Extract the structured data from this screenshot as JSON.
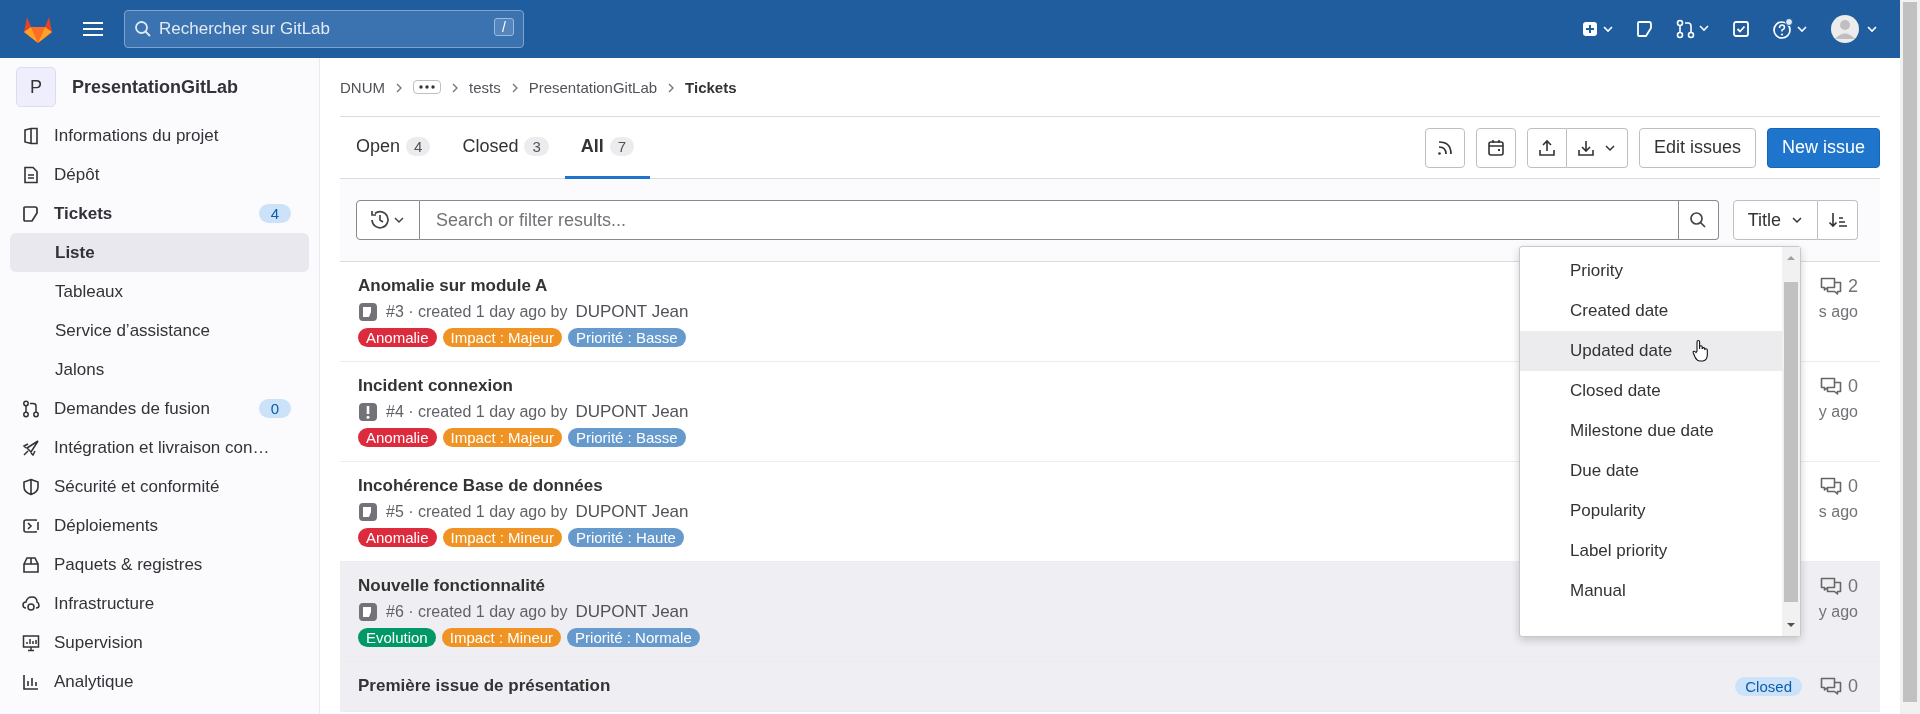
{
  "topbar": {
    "search_placeholder": "Rechercher sur GitLab",
    "search_shortcut": "/"
  },
  "project": {
    "avatar_letter": "P",
    "name": "PresentationGitLab"
  },
  "sidebar": {
    "items": [
      {
        "label": "Informations du projet",
        "selected": false,
        "expanded": false
      },
      {
        "label": "Dépôt",
        "selected": false,
        "expanded": false
      },
      {
        "label": "Tickets",
        "selected": false,
        "expanded": true,
        "badge": "4",
        "children": [
          {
            "label": "Liste",
            "selected": true
          },
          {
            "label": "Tableaux",
            "selected": false
          },
          {
            "label": "Service d’assistance",
            "selected": false
          },
          {
            "label": "Jalons",
            "selected": false
          }
        ]
      },
      {
        "label": "Demandes de fusion",
        "selected": false,
        "expanded": false,
        "badge": "0"
      },
      {
        "label": "Intégration et livraison con…",
        "selected": false,
        "expanded": false
      },
      {
        "label": "Sécurité et conformité",
        "selected": false,
        "expanded": false
      },
      {
        "label": "Déploiements",
        "selected": false,
        "expanded": false
      },
      {
        "label": "Paquets & registres",
        "selected": false,
        "expanded": false
      },
      {
        "label": "Infrastructure",
        "selected": false,
        "expanded": false
      },
      {
        "label": "Supervision",
        "selected": false,
        "expanded": false
      },
      {
        "label": "Analytique",
        "selected": false,
        "expanded": false
      }
    ]
  },
  "breadcrumb": [
    {
      "kind": "link",
      "label": "DNUM"
    },
    {
      "kind": "more"
    },
    {
      "kind": "link",
      "label": "tests"
    },
    {
      "kind": "link",
      "label": "PresentationGitLab"
    },
    {
      "kind": "current",
      "label": "Tickets"
    }
  ],
  "tabs": [
    {
      "label": "Open",
      "count": "4",
      "selected": false
    },
    {
      "label": "Closed",
      "count": "3",
      "selected": false
    },
    {
      "label": "All",
      "count": "7",
      "selected": true
    }
  ],
  "actions": {
    "edit_button": "Edit issues",
    "new_button": "New issue"
  },
  "filter": {
    "placeholder": "Search or filter results...",
    "sort_label": "Title"
  },
  "issues": [
    {
      "title": "Anomalie sur module A",
      "kind": "issue",
      "ref": "#3 · created 1 day ago by",
      "author": "DUPONT Jean",
      "closed": false,
      "comments": "2",
      "updated": "s ago",
      "labels": [
        {
          "text": "Anomalie",
          "color": "#dd2b3e"
        },
        {
          "text": "Impact : Majeur",
          "color": "#ef9424"
        },
        {
          "text": "Priorité : Basse",
          "color": "#6699cc"
        }
      ]
    },
    {
      "title": "Incident connexion",
      "kind": "incident",
      "ref": "#4 · created 1 day ago by",
      "author": "DUPONT Jean",
      "closed": false,
      "comments": "0",
      "updated": "y ago",
      "labels": [
        {
          "text": "Anomalie",
          "color": "#dd2b3e"
        },
        {
          "text": "Impact : Majeur",
          "color": "#ef9424"
        },
        {
          "text": "Priorité : Basse",
          "color": "#6699cc"
        }
      ]
    },
    {
      "title": "Incohérence Base de données",
      "kind": "issue",
      "ref": "#5 · created 1 day ago by",
      "author": "DUPONT Jean",
      "closed": false,
      "comments": "0",
      "updated": "s ago",
      "labels": [
        {
          "text": "Anomalie",
          "color": "#dd2b3e"
        },
        {
          "text": "Impact : Mineur",
          "color": "#ef9424"
        },
        {
          "text": "Priorité : Haute",
          "color": "#6699cc"
        }
      ]
    },
    {
      "title": "Nouvelle fonctionnalité",
      "kind": "issue",
      "ref": "#6 · created 1 day ago by",
      "author": "DUPONT Jean",
      "closed": true,
      "comments": "0",
      "updated": "y ago",
      "labels": [
        {
          "text": "Evolution",
          "color": "#009966"
        },
        {
          "text": "Impact : Mineur",
          "color": "#ef9424"
        },
        {
          "text": "Priorité : Normale",
          "color": "#6699cc"
        }
      ]
    },
    {
      "title": "Première issue de présentation",
      "closed": true,
      "status": "Closed",
      "comments": "0"
    }
  ],
  "sort_menu": {
    "items": [
      {
        "label": "Priority",
        "hovered": false
      },
      {
        "label": "Created date",
        "hovered": false
      },
      {
        "label": "Updated date",
        "hovered": true
      },
      {
        "label": "Closed date",
        "hovered": false
      },
      {
        "label": "Milestone due date",
        "hovered": false
      },
      {
        "label": "Due date",
        "hovered": false
      },
      {
        "label": "Popularity",
        "hovered": false
      },
      {
        "label": "Label priority",
        "hovered": false
      },
      {
        "label": "Manual",
        "hovered": false
      }
    ]
  }
}
